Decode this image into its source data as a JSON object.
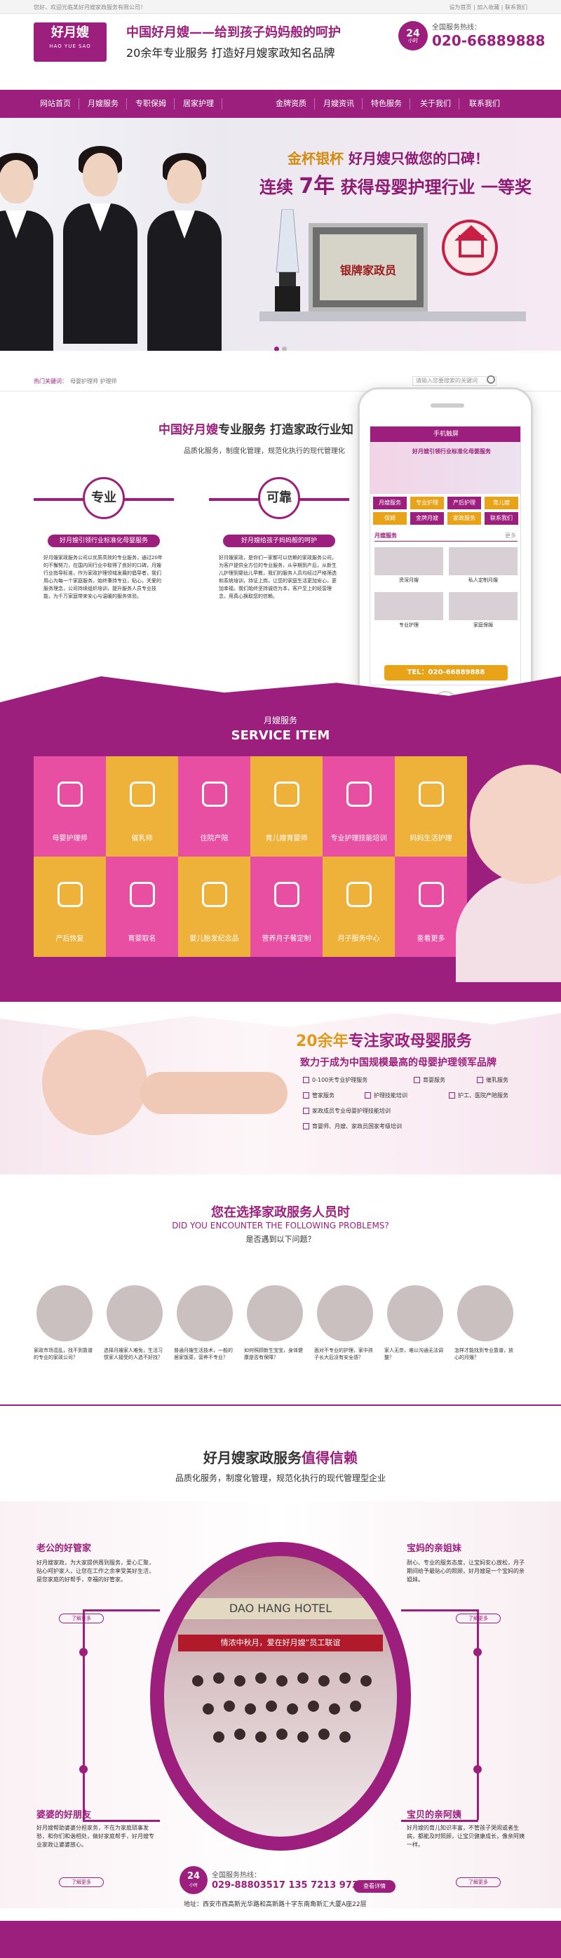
{
  "topbar": {
    "left": "您好，欢迎光临某好月嫂家政服务有限公司！",
    "right": "设为首页 | 加入收藏 | 联系我们"
  },
  "header": {
    "logo_text": "好月嫂",
    "logo_en": "HAO YUE SAO",
    "slogan1": "中国好月嫂——给到孩子妈妈般的呵护",
    "slogan2": "20余年专业服务 打造好月嫂家政知名品牌",
    "badge_num": "24",
    "badge_txt": "小时",
    "hotline_label": "全国服务热线：",
    "hotline": "020-66889888"
  },
  "nav": [
    "网站首页",
    "月嫂服务",
    "专职保姆",
    "居家护理",
    "金牌资质",
    "月嫂资讯",
    "特色服务",
    "关于我们",
    "联系我们"
  ],
  "banner": {
    "line1_gold": "金杯银杯",
    "line1_rest": "好月嫂只做您的口碑！",
    "line2a": "连续",
    "line2num": "7年",
    "line2b": "获得母婴护理行业",
    "line2c": "一等奖",
    "plaque": "银牌家政员"
  },
  "hotbar": {
    "label": "热门关键词：",
    "keywords": "母婴护理师   护理师",
    "search_placeholder": "请输入您要搜索的关键词"
  },
  "intro": {
    "title_a": "中国好月嫂",
    "title_b": "专业服务 打造家政行业知",
    "subtitle": "品质化服务，制度化管理，规范化执行的现代管理化",
    "cards": [
      {
        "tag": "专业",
        "pill": "好月嫂引领行业标准化母婴服务",
        "text": "好月嫂家政服务公司以优质高效的专业服务，通过20年的不懈努力，在国内同行业中取得了良好的口碑，月嫂行业指导标准，作为家政护理领域发展的倡导者，我们用心为每一个家庭服务。始终秉持专业，贴心，关爱的服务理念，公司持续组织培训，提升服务人员专业技能，为千万家庭带来安心与温暖的服务体验。"
      },
      {
        "tag": "可靠",
        "pill": "好月嫂给孩子妈妈般的呵护",
        "text": "好月嫂家政，是你们一家都可以信赖的家政服务公司，为客户提供全方位的专业服务，从孕期到产后，从新生儿护理到婴幼儿早教，我们的服务人员均经过严格筛选和系统培训，持证上岗，让您的家庭生活更加安心，更加幸福，我们始终坚持诚信为本，客户至上的经营理念，用真心换取您的信赖。"
      }
    ]
  },
  "phone": {
    "bar_title": "手机触屏",
    "img_text": "好月嫂引领行业标准化母婴服务",
    "buttons": [
      "月嫂服务",
      "专业护理",
      "产后护理",
      "育儿嫂",
      "保姆",
      "金牌月嫂",
      "家政服务",
      "联系我们"
    ],
    "section": "月嫂服务",
    "more": "更多",
    "captions": [
      "资深月嫂",
      "私人定制月嫂",
      "专业护理",
      "家庭保姆"
    ],
    "tel": "TEL：020-66889888"
  },
  "service": {
    "title_cn": "月嫂服务",
    "title_en": "SERVICE ITEM",
    "items": [
      "母婴护理师",
      "催乳师",
      "住院产陪",
      "育儿嫂育婴师",
      "专业护理技能培训",
      "妈妈生活护理",
      "产后恢复",
      "育婴取名",
      "婴儿胎发纪念品",
      "营养月子餐定制",
      "月子服务中心",
      "查看更多"
    ],
    "colors": [
      "#e84fa3",
      "#eeb23a",
      "#e84fa3",
      "#eeb23a",
      "#e84fa3",
      "#eeb23a",
      "#eeb23a",
      "#e84fa3",
      "#eeb23a",
      "#e84fa3",
      "#eeb23a",
      "#e84fa3"
    ]
  },
  "pro": {
    "title_num": "20余年",
    "title_rest": "专注家政母婴服务",
    "subtitle": "致力于成为中国规模最高的母婴护理领军品牌",
    "list": [
      "0-100天专业护理服务",
      "育婴服务",
      "催乳服务",
      "管家服务",
      "护理技能培训",
      "护工、医院产陪服务",
      "家政成员专业母婴护理技能培训",
      "育婴师、月嫂、家政员国家考级培训"
    ]
  },
  "problems": {
    "title": "您在选择家政服务人员时",
    "title_en": "DID YOU ENCOUNTER THE FOLLOWING PROBLEMS?",
    "sub": "是否遇到以下问题？",
    "items": [
      "家政市场混乱，找不到靠谱的专业的家政公司？",
      "选择月嫂家人难免，生活习惯家人接受的人选不好找？",
      "普通月嫂生活技术，一般的居家饭菜，营养不专业？",
      "如何照顾新生宝宝，身体健康是否有保障？",
      "面对不专业的护理，家中孩子长大后没有安全感？",
      "家人无奈，难以沟通无法调整？",
      "怎样才能找到专业靠谱，放心的月嫂？"
    ]
  },
  "trust": {
    "title_a": "好月嫂家政服务",
    "title_b": "值得信赖",
    "subtitle": "品质化服务，制度化管理，规范化执行的现代管理型企业",
    "photo_sign": "DAO HANG HOTEL",
    "photo_banner": "情浓中秋月，爱在好月嫂”员工联谊",
    "blocks": [
      {
        "title": "老公的好管家",
        "text": "好月嫂家政，为大家提供周到服务，爱心汇聚，贴心呵护家人，让您在工作之余享受美好生活，是您家庭的好帮手，幸福的好管家。",
        "btn": "了解更多"
      },
      {
        "title": "宝妈的亲姐妹",
        "text": "耐心、专业的服务态度，让宝妈安心放松，月子期间给予最贴心的照顾，好月嫂是一个宝妈的亲姐妹。",
        "btn": "了解更多"
      },
      {
        "title": "婆婆的好朋友",
        "text": "好月嫂帮助婆婆分担家务，不在为家庭琐事发愁，和你们和谐相处，做好家庭帮手，好月嫂专业家政让婆婆放心。",
        "btn": "了解更多"
      },
      {
        "title": "宝贝的亲阿姨",
        "text": "好月嫂的育儿知识丰富，不管孩子哭闹或者生病，都能及时照顾，让宝贝健康成长，像亲阿姨一样。",
        "btn": "了解更多"
      }
    ]
  },
  "footer": {
    "badge_num": "24",
    "badge_txt": "小时",
    "hotline_label": "全国服务热线：",
    "hotline": "029-88803517  135 7213 9737",
    "btn": "查看详情",
    "address": "地址：西安市西高新光华路和高新路十字东南角新汇大厦A座22层"
  }
}
